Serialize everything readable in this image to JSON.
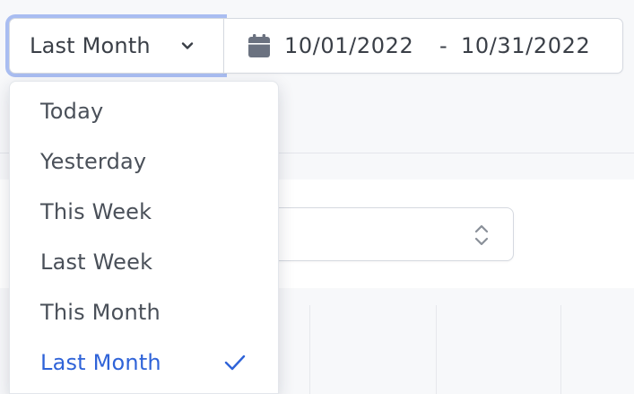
{
  "date_range": {
    "preset_selected": "Last Month",
    "start_date": "10/01/2022",
    "separator": "-",
    "end_date": "10/31/2022"
  },
  "preset_menu": {
    "items": [
      {
        "label": "Today",
        "selected": false
      },
      {
        "label": "Yesterday",
        "selected": false
      },
      {
        "label": "This Week",
        "selected": false
      },
      {
        "label": "Last Week",
        "selected": false
      },
      {
        "label": "This Month",
        "selected": false
      },
      {
        "label": "Last Month",
        "selected": true
      }
    ]
  },
  "icons": {
    "preset_toggle": "chevron-down-icon",
    "range_field": "calendar-icon",
    "selected_marker": "check-icon",
    "panel_select": "chevron-up-down-icon"
  },
  "colors": {
    "accent": "#2f63d8",
    "focus_ring": "#a9bdf1",
    "text": "#3a3f47",
    "icon": "#6b7280"
  }
}
